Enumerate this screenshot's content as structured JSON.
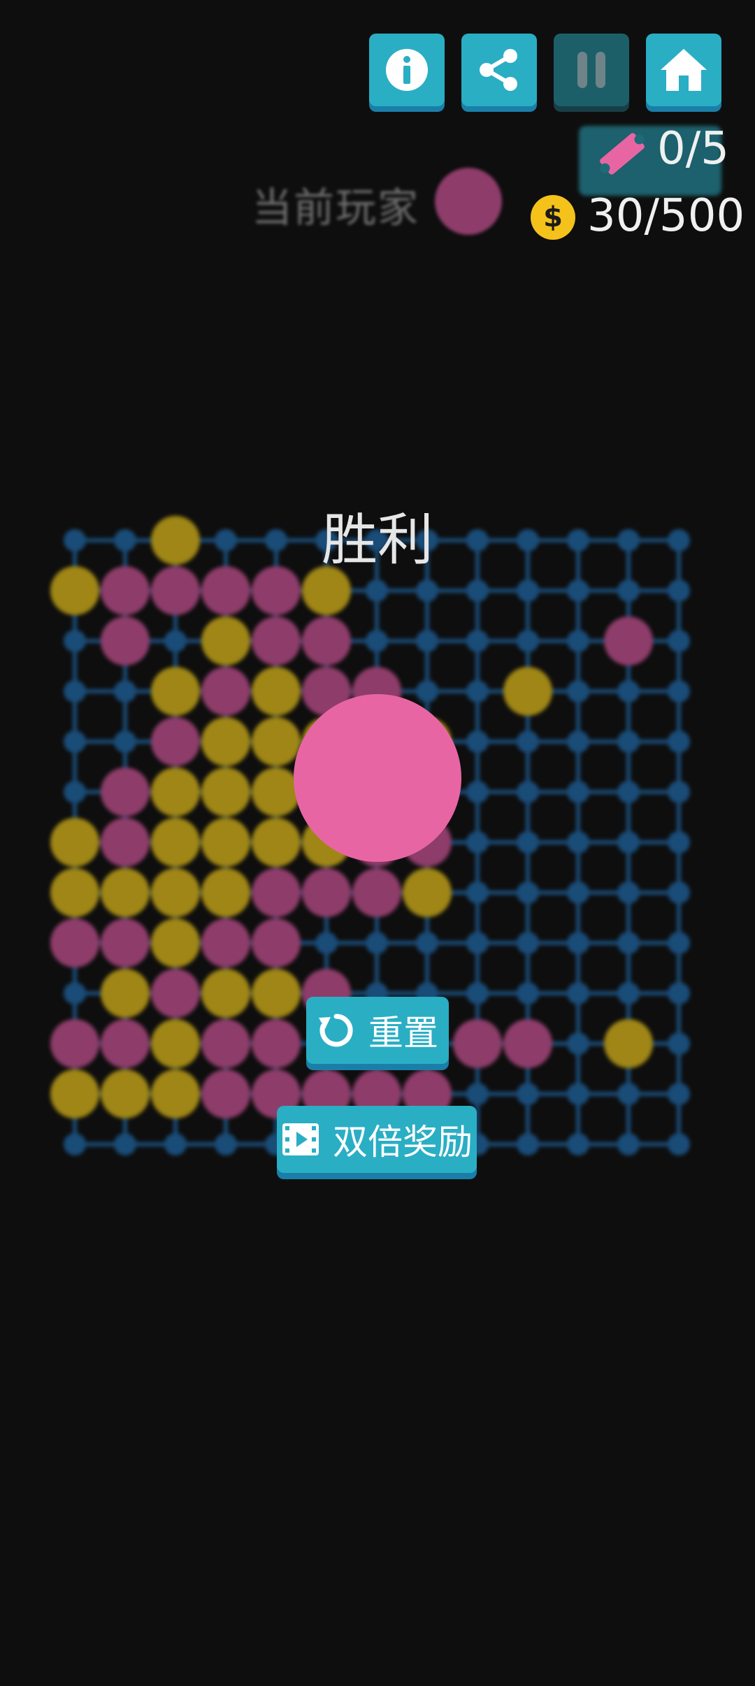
{
  "header": {
    "buttons": [
      {
        "icon": "info-icon"
      },
      {
        "icon": "share-icon"
      },
      {
        "icon": "pause-icon"
      },
      {
        "icon": "home-icon"
      }
    ],
    "tickets": "0/5",
    "coins": "30/500"
  },
  "status": {
    "current_player_label": "当前玩家",
    "current_player_color": "#8e3d6a"
  },
  "result": {
    "title": "胜利",
    "winner_color": "#e865a4"
  },
  "actions": {
    "reset_label": "重置",
    "double_label": "双倍奖励"
  },
  "board": {
    "cols": 13,
    "rows": 13,
    "colors": {
      "line": "#1a4c78",
      "node": "#1a4c78",
      "P": "#8e3d6a",
      "Y": "#9f8616"
    },
    "stones": [
      "..Y..........",
      "YPPPPY.......",
      ".P.YPP.....P.",
      "..YPYPP..Y...",
      "..PYYY.Y.....",
      ".PYYY.P......",
      "YPYYYYPP.....",
      "YYYYPPPY.....",
      "PPYPP........",
      ".YPYYP.......",
      "PPYPP...PP.Y.",
      "YYYPPPPP.....",
      "............."
    ]
  }
}
